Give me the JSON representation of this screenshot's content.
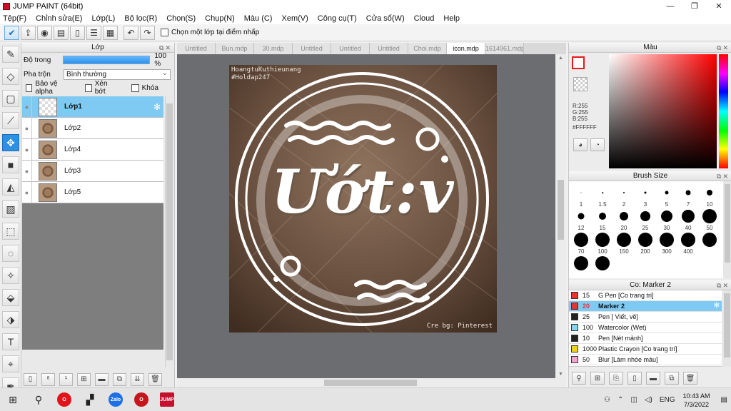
{
  "window": {
    "title": "JUMP PAINT (64bit)",
    "min": "—",
    "max": "❐",
    "close": "✕"
  },
  "menu": [
    "Tệp(F)",
    "Chỉnh sửa(E)",
    "Lớp(L)",
    "Bộ lọc(R)",
    "Chọn(S)",
    "Chụp(N)",
    "Màu (C)",
    "Xem(V)",
    "Công cụ(T)",
    "Cửa sổ(W)",
    "Cloud",
    "Help"
  ],
  "toolbar": {
    "select_layer_label": "Chọn một lớp tại điểm nhấp"
  },
  "layers_panel": {
    "title": "Lớp",
    "opacity_label": "Độ trong",
    "opacity_value": "100 %",
    "opacity": 1.0,
    "blend_label": "Pha trộn",
    "blend_value": "Bình thường",
    "protect_alpha": "Bảo vệ alpha",
    "clip": "Xén bớt",
    "lock": "Khóa",
    "layers": [
      {
        "name": "Lớp1",
        "selected": true,
        "transparent": true
      },
      {
        "name": "Lớp2",
        "selected": false,
        "transparent": false
      },
      {
        "name": "Lớp4",
        "selected": false,
        "transparent": false
      },
      {
        "name": "Lớp3",
        "selected": false,
        "transparent": false
      },
      {
        "name": "Lớp5",
        "selected": false,
        "transparent": false
      }
    ]
  },
  "doc_tabs": [
    "Untitled",
    "Bun.mdp",
    "30.mdp",
    "Untitled",
    "Untitled",
    "Untitled",
    "Choi.mdp",
    "icon.mdp",
    "1614961.mdp"
  ],
  "active_tab": "icon.mdp",
  "artwork": {
    "top_text_1": "HoangtuKuthieunang",
    "top_text_2": "#Holdap247",
    "title": "Ướt:v",
    "credit": "Cre bg: Pinterest"
  },
  "color_panel": {
    "title": "Màu",
    "r": "R:255",
    "g": "G:255",
    "b": "B:255",
    "hex": "#FFFFFF",
    "primary": "#FFFFFF",
    "accent": "#E21B1B"
  },
  "brush_panel": {
    "title": "Brush Size",
    "sizes": [
      "1",
      "1.5",
      "2",
      "3",
      "5",
      "7",
      "10",
      "12",
      "15",
      "20",
      "25",
      "30",
      "40",
      "50",
      "70",
      "100",
      "150",
      "200",
      "300",
      "400",
      "",
      "",
      ""
    ]
  },
  "tool_panel": {
    "title": "Co: Marker 2",
    "items": [
      {
        "size": "15",
        "name": "G Pen [Co trang tri]",
        "color": "#E8332E",
        "selected": false
      },
      {
        "size": "20",
        "name": "Marker 2",
        "color": "#E8332E",
        "selected": true
      },
      {
        "size": "25",
        "name": "Pen [ Viết, vẽ]",
        "color": "#222222",
        "selected": false
      },
      {
        "size": "100",
        "name": "Watercolor (Wet)",
        "color": "#7fd6f0",
        "selected": false
      },
      {
        "size": "10",
        "name": "Pen [Nét mảnh]",
        "color": "#222222",
        "selected": false
      },
      {
        "size": "1000",
        "name": "Plastic Crayon [Co trang trí]",
        "color": "#f0d21b",
        "selected": false
      },
      {
        "size": "50",
        "name": "Blur [Làm nhòe màu]",
        "color": "#f4a6d3",
        "selected": false
      }
    ]
  },
  "taskbar": {
    "lang": "ENG",
    "time": "10:43 AM",
    "date": "7/3/2022",
    "zalo": "Zalo",
    "jump": "JUMP"
  }
}
